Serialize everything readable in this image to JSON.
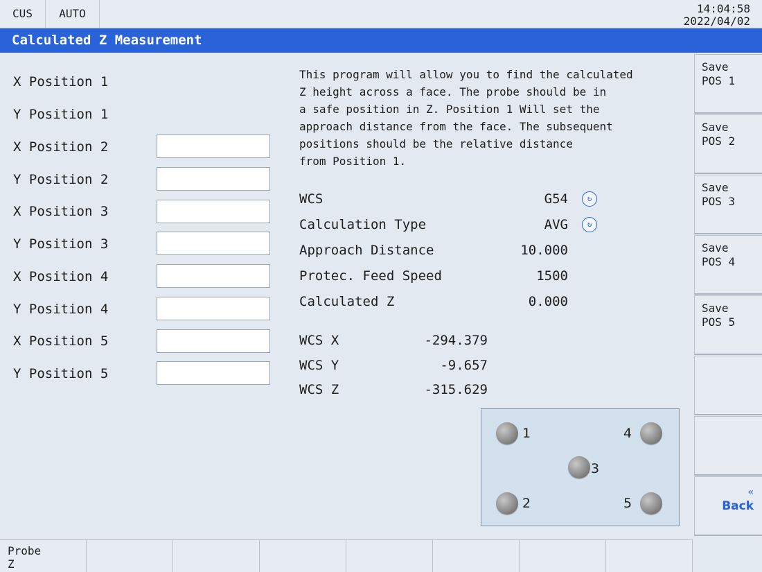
{
  "topbar": {
    "tab_cus": "CUS",
    "tab_auto": "AUTO",
    "time": "14:04:58",
    "date": "2022/04/02"
  },
  "title": "Calculated Z Measurement",
  "positions": [
    {
      "label": "X Position 1",
      "has_input": false,
      "value": ""
    },
    {
      "label": "Y Position 1",
      "has_input": false,
      "value": ""
    },
    {
      "label": "X Position 2",
      "has_input": true,
      "value": ""
    },
    {
      "label": "Y Position 2",
      "has_input": true,
      "value": ""
    },
    {
      "label": "X Position 3",
      "has_input": true,
      "value": ""
    },
    {
      "label": "Y Position 3",
      "has_input": true,
      "value": ""
    },
    {
      "label": "X Position 4",
      "has_input": true,
      "value": ""
    },
    {
      "label": "Y Position 4",
      "has_input": true,
      "value": ""
    },
    {
      "label": "X Position 5",
      "has_input": true,
      "value": ""
    },
    {
      "label": "Y Position 5",
      "has_input": true,
      "value": ""
    }
  ],
  "description": "This program will allow you to find the calculated\nZ height across a face. The probe should be in\na safe position in Z. Position 1 Will set the\napproach distance from the face. The subsequent\npositions should be the relative distance\nfrom Position 1.",
  "params": {
    "wcs": {
      "label": "WCS",
      "value": "G54"
    },
    "calc_type": {
      "label": "Calculation Type",
      "value": "AVG"
    },
    "approach": {
      "label": "Approach Distance",
      "value": "10.000"
    },
    "feed": {
      "label": "Protec. Feed Speed",
      "value": "1500"
    },
    "calc_z": {
      "label": "Calculated Z",
      "value": "0.000"
    }
  },
  "wcs_coords": {
    "x": {
      "label": "WCS X",
      "value": "-294.379"
    },
    "y": {
      "label": "WCS Y",
      "value": "-9.657"
    },
    "z": {
      "label": "WCS Z",
      "value": "-315.629"
    }
  },
  "diagram": {
    "points": [
      "1",
      "2",
      "3",
      "4",
      "5"
    ]
  },
  "side_buttons": [
    {
      "line1": "Save",
      "line2": "POS 1"
    },
    {
      "line1": "Save",
      "line2": "POS 2"
    },
    {
      "line1": "Save",
      "line2": "POS 3"
    },
    {
      "line1": "Save",
      "line2": "POS 4"
    },
    {
      "line1": "Save",
      "line2": "POS 5"
    }
  ],
  "back_button": {
    "chevron": "«",
    "label": "Back"
  },
  "soft_keys": [
    {
      "line1": "Probe",
      "line2": "Z"
    }
  ],
  "icons": {
    "cycle": "cycle-icon"
  },
  "colors": {
    "accent": "#2a62d9",
    "background": "#e3e9f0"
  }
}
